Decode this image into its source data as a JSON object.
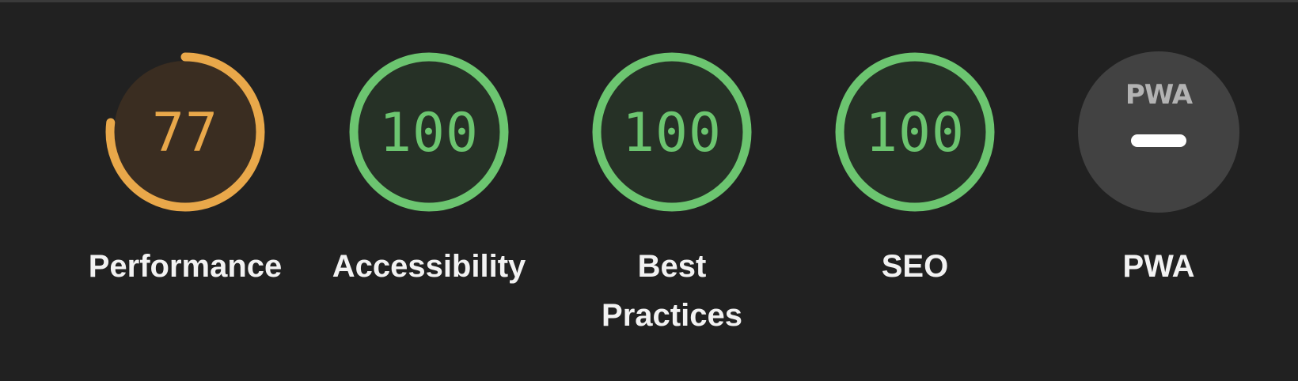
{
  "colors": {
    "background": "#212121",
    "pass_color": "#6cc570",
    "pass_fill": "#263126",
    "average_color": "#e9a84a",
    "average_fill": "#3a2d21",
    "neutral_fill": "#424242"
  },
  "gauges": [
    {
      "label": "Performance",
      "score": "77",
      "fraction": 0.77,
      "status": "average"
    },
    {
      "label": "Accessibility",
      "score": "100",
      "fraction": 1.0,
      "status": "pass"
    },
    {
      "label": "Best Practices",
      "score": "100",
      "fraction": 1.0,
      "status": "pass"
    },
    {
      "label": "SEO",
      "score": "100",
      "fraction": 1.0,
      "status": "pass"
    },
    {
      "label": "PWA",
      "logo_text": "PWA",
      "status": "neutral"
    }
  ]
}
